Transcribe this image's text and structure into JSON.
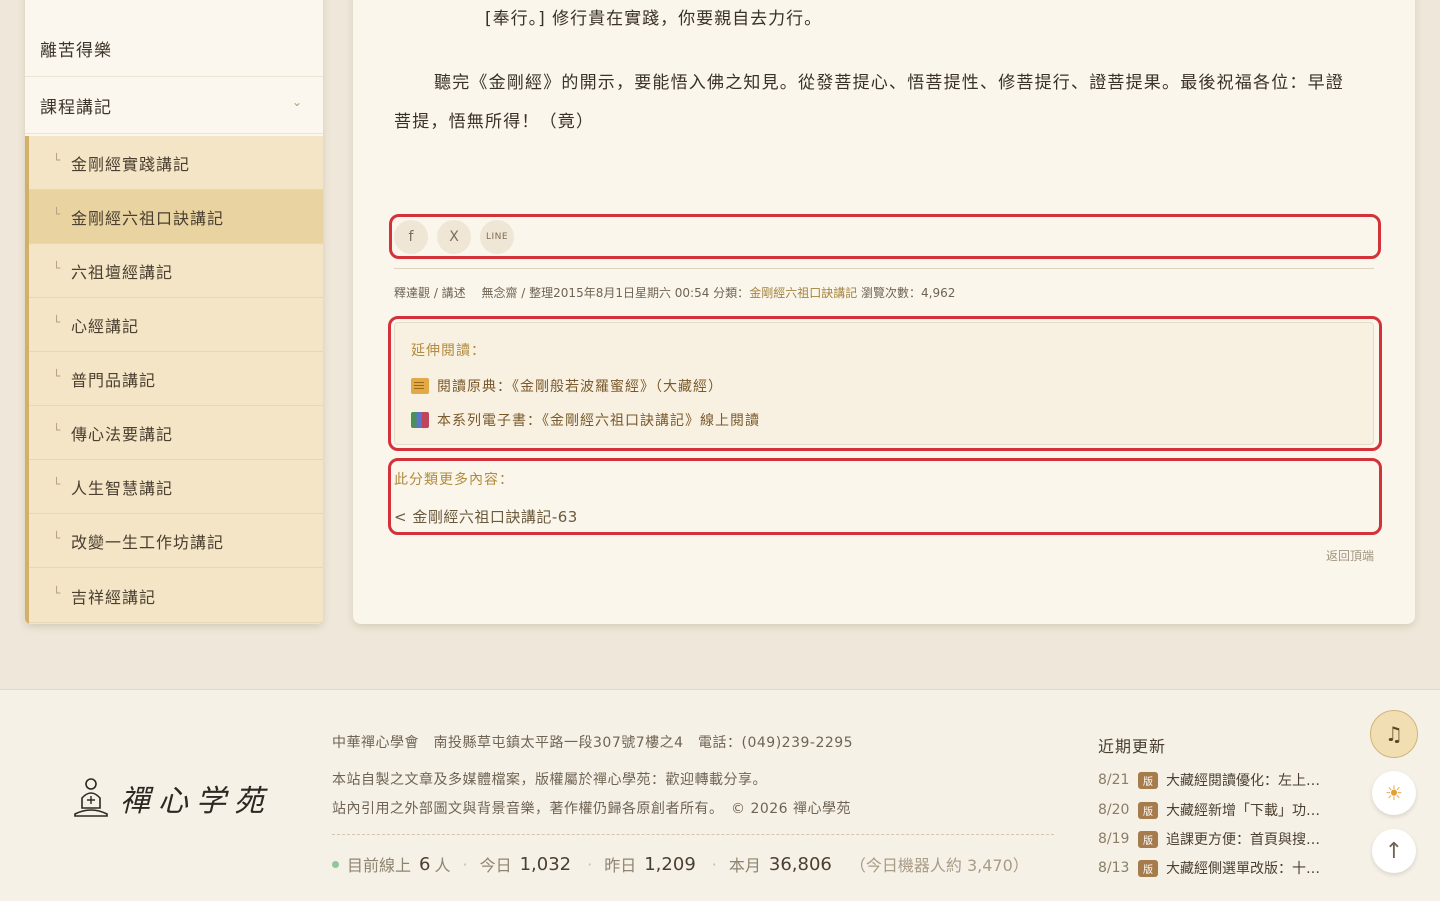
{
  "sidebar": {
    "top_items": [
      {
        "label": "離苦得樂"
      },
      {
        "label": "課程講記"
      }
    ],
    "sub_items": [
      {
        "label": "金剛經實踐講記"
      },
      {
        "label": "金剛經六祖口訣講記",
        "active": true
      },
      {
        "label": "六祖壇經講記"
      },
      {
        "label": "心經講記"
      },
      {
        "label": "普門品講記"
      },
      {
        "label": "傳心法要講記"
      },
      {
        "label": "人生智慧講記"
      },
      {
        "label": "改變一生工作坊講記"
      },
      {
        "label": "吉祥經講記"
      }
    ],
    "branch_glyph": "└",
    "chevron": "⌄"
  },
  "article": {
    "para1": "[奉行。] 修行貴在實踐，你要親自去力行。",
    "para2": "聽完《金剛經》的開示，要能悟入佛之知見。從發菩提心、悟菩提性、修菩提行、證菩提果。最後祝福各位：早證菩提，悟無所得！（竟）"
  },
  "share": {
    "facebook": "f",
    "x": "X",
    "line": "LINE"
  },
  "meta": {
    "prefix": "釋達觀 / 講述　 無念齋 / 整理2015年8月1日星期六 00:54 分類：",
    "category": "金剛經六祖口訣講記",
    "views": " 瀏覽次數：4,962"
  },
  "extended": {
    "title": "延伸閱讀：",
    "link1": "閱讀原典：《金剛般若波羅蜜經》（大藏經）",
    "link2": "本系列電子書：《金剛經六祖口訣講記》線上閱讀",
    "icon1": "scroll-icon",
    "icon2": "books-icon"
  },
  "more": {
    "title": "此分類更多內容：",
    "link": "< 金剛經六祖口訣講記-63"
  },
  "back_to_top": "返回頂端",
  "footer": {
    "logo_text": "禪心学苑",
    "address": "中華禪心學會　南投縣草屯鎮太平路一段307號7樓之4　電話：(049)239-2295",
    "copy1": "本站自製之文章及多媒體檔案，版權屬於禪心學苑：歡迎轉載分享。",
    "copy2": "站內引用之外部圖文與背景音樂，著作權仍歸各原創者所有。　© 2026 禪心學苑",
    "stats": {
      "online_label": "目前線上",
      "online_value": "6",
      "online_unit": "人",
      "today_label": "今日",
      "today_value": "1,032",
      "yesterday_label": "昨日",
      "yesterday_value": "1,209",
      "month_label": "本月",
      "month_value": "36,806",
      "bots": "（今日機器人約 3,470）",
      "sep": "·"
    },
    "updates_title": "近期更新",
    "updates": [
      {
        "date": "8/21",
        "badge": "版",
        "text": "大藏經閱讀優化：左上…"
      },
      {
        "date": "8/20",
        "badge": "版",
        "text": "大藏經新增「下載」功…"
      },
      {
        "date": "8/19",
        "badge": "版",
        "text": "追課更方便：首頁與搜…"
      },
      {
        "date": "8/13",
        "badge": "版",
        "text": "大藏經側選單改版：十…"
      }
    ]
  },
  "fabs": {
    "music": "♫",
    "theme": "☀",
    "top": "↑"
  },
  "colors": {
    "accent_gold": "#d3b06a",
    "highlight_red": "#d4323b",
    "background": "#efe8da"
  }
}
